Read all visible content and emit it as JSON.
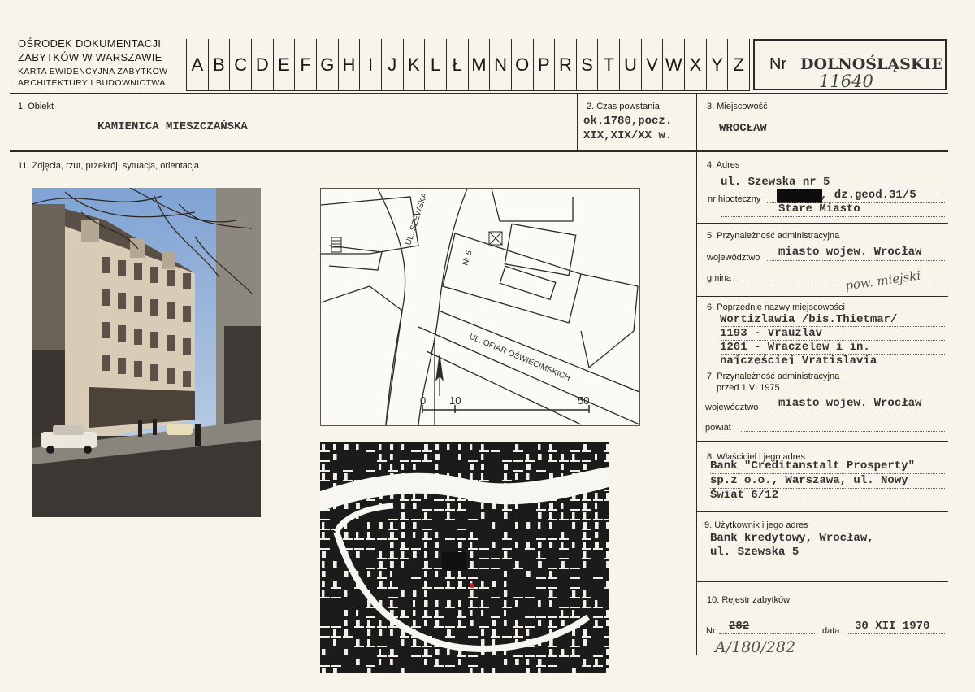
{
  "header": {
    "org_line1": "OŚRODEK DOKUMENTACJI",
    "org_line2": "ZABYTKÓW W WARSZAWIE",
    "card_line1": "KARTA EWIDENCYJNA ZABYTKÓW",
    "card_line2": "ARCHITEKTURY I BUDOWNICTWA",
    "letters": [
      "A",
      "B",
      "C",
      "D",
      "E",
      "F",
      "G",
      "H",
      "I",
      "J",
      "K",
      "L",
      "Ł",
      "M",
      "N",
      "O",
      "P",
      "R",
      "S",
      "T",
      "U",
      "V",
      "W",
      "X",
      "Y",
      "Z"
    ],
    "nr_label": "Nr",
    "nr_value": "DOLNOŚLĄSKIE",
    "nr_handwritten": "11640"
  },
  "field1": {
    "label": "1. Obiekt",
    "value": "KAMIENICA MIESZCZAŃSKA"
  },
  "field2": {
    "label": "2. Czas powstania",
    "line1": "ok.1780,pocz.",
    "line2": "XIX,XIX/XX w."
  },
  "field3": {
    "label": "3. Miejscowość",
    "value": "WROCŁAW"
  },
  "field11": {
    "label": "11. Zdjęcia, rzut, przekrój, sytuacja, orientacja"
  },
  "site_plan": {
    "street1": "UL. SZEWSKA",
    "number": "Nr 5",
    "street2": "UL. OFIAR OŚWIĘCIMSKICH",
    "scale_0": "0",
    "scale_10": "10",
    "scale_50": "50"
  },
  "field4": {
    "label": "4. Adres",
    "line1": "ul. Szewska nr 5",
    "hip_label": "nr hipoteczny",
    "line2": ", dz.geod.31/5",
    "line3": "Stare Miasto"
  },
  "field5": {
    "label": "5. Przynależność administracyjna",
    "woj_label": "województwo",
    "woj_value": "miasto wojew. Wrocław",
    "gmina_label": "gmina",
    "gmina_handwritten": "pow. miejski"
  },
  "field6": {
    "label": "6. Poprzednie nazwy miejscowości",
    "line1": "Wortizlawia /bis.Thietmar/",
    "line2": "1193 - Vrauzlav",
    "line3": "1201 - Wraczelew i in.",
    "line4": "najczęściej Vratislavia"
  },
  "field7": {
    "label": "7. Przynależność administracyjna",
    "sub": "przed 1 VI 1975",
    "woj_label": "województwo",
    "woj_value": "miasto wojew. Wrocław",
    "powiat_label": "powiat"
  },
  "field8": {
    "label": "8. Właściciel i jego adres",
    "line1": "Bank \"Creditanstalt Prosperty\"",
    "line2": "sp.z o.o., Warszawa, ul. Nowy",
    "line3": "Świat 6/12"
  },
  "field9": {
    "label": "9. Użytkownik i jego adres",
    "line1": "Bank kredytowy, Wrocław,",
    "line2": "ul. Szewska 5"
  },
  "field10": {
    "label": "10. Rejestr zabytków",
    "nr_label": "Nr",
    "nr_value": "282",
    "data_label": "data",
    "data_value": "30 XII 1970",
    "handwritten": "A/180/282"
  }
}
